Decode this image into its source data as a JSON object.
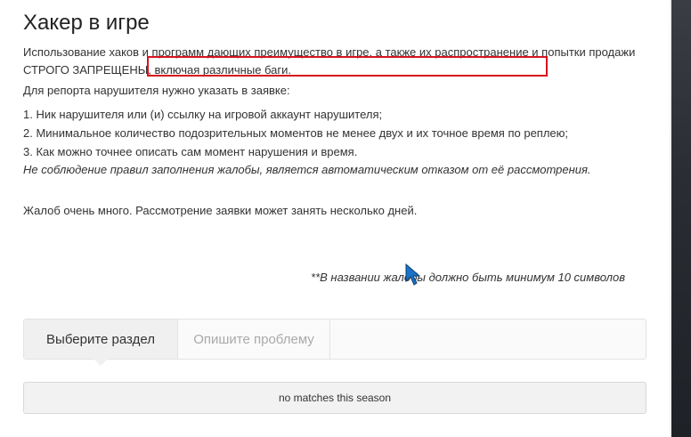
{
  "title": "Хакер в игре",
  "intro": {
    "line1": "Использование хаков и программ дающих преимущество в игре, а также их распространение и попытки продажи",
    "line2_a": "СТРОГО ЗАПРЕЩЕНЫ",
    "line2_b": ", включая различные баги."
  },
  "report_intro": "Для репорта нарушителя нужно указать в заявке:",
  "requirements": [
    "1. Ник нарушителя или (и) ссылку на игровой аккаунт нарушителя;",
    "2. Минимальное количество подозрительных моментов не менее двух и их точное время по реплею;",
    "3. Как можно точнее описать сам момент нарушения и время."
  ],
  "warning": "Не соблюдение правил заполнения жалобы, является автоматическим отказом от её рассмотрения.",
  "many_complaints": "Жалоб очень много. Рассмотрение заявки может занять несколько дней.",
  "title_note": "**В названии жалобы должно быть минимум 10 символов",
  "tabs": [
    "Выберите раздел",
    "Опишите проблему"
  ],
  "match_bar": "no matches this season",
  "colors": {
    "highlight": "#d7141e",
    "cursor": "#1a73c8"
  },
  "icons": {
    "cursor": "mouse-pointer-icon"
  }
}
